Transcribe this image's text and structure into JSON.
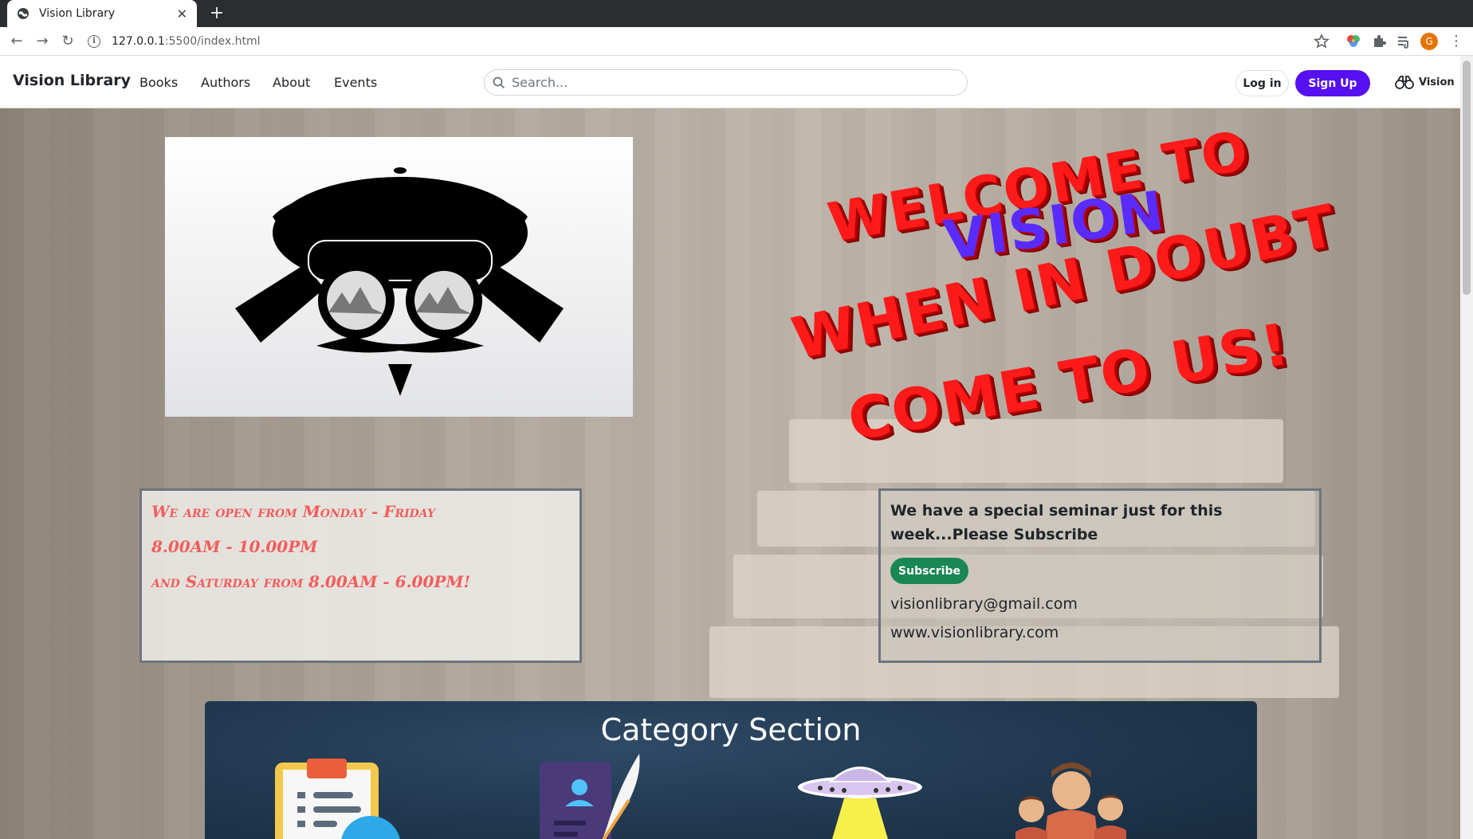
{
  "browser": {
    "tab_title": "Vision Library",
    "url_host": "127.0.0.1",
    "url_path": ":5500/index.html",
    "new_tab_label": "+",
    "close_label": "✕",
    "profile_initial": "G"
  },
  "header": {
    "brand": "Vision Library",
    "nav": [
      "Books",
      "Authors",
      "About",
      "Events"
    ],
    "search_placeholder": "Search...",
    "login_label": "Log in",
    "signup_label": "Sign Up",
    "vision_label": "Vision"
  },
  "hero": {
    "welcome_lines": [
      "WELCOME TO",
      "VISION",
      "WHEN IN DOUBT",
      "COME TO US!"
    ]
  },
  "hours": {
    "lines": [
      "We are open from Monday - Friday",
      "8.00AM - 10.00PM",
      "and Saturday from 8.00AM - 6.00PM!"
    ]
  },
  "seminar": {
    "text": "We have a special seminar just for this week...Please Subscribe",
    "subscribe_label": "Subscribe",
    "email": "visionlibrary@gmail.com",
    "website": "www.visionlibrary.com"
  },
  "category": {
    "title": "Category Section",
    "icons": [
      "checklist-icon",
      "author-writing-icon",
      "ufo-icon",
      "people-icon"
    ]
  },
  "colors": {
    "accent_purple": "#5610f2",
    "subscribe_green": "#198754",
    "hours_red": "#f25d5d",
    "welcome_red": "#ff1a1a",
    "welcome_blue": "#5a2bff"
  }
}
